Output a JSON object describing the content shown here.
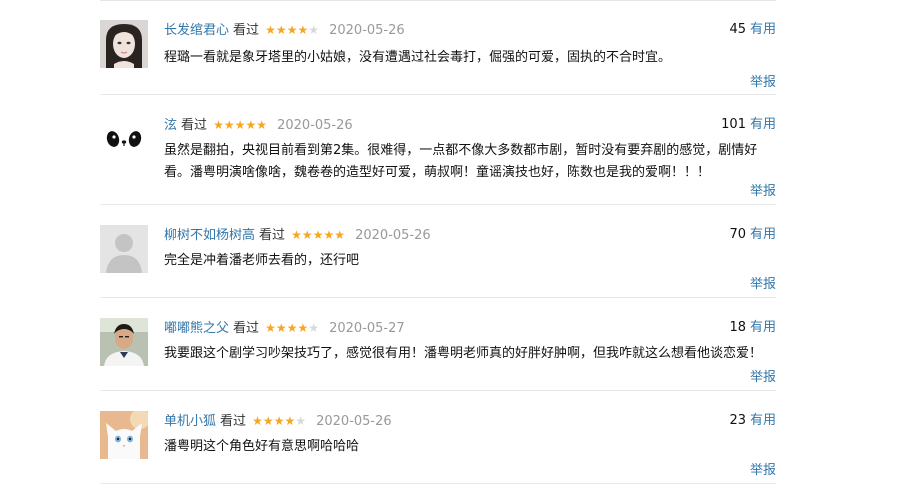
{
  "common": {
    "watched_label": "看过",
    "useful_label": "有用",
    "report_label": "举报"
  },
  "comments": [
    {
      "user": "长发绾君心",
      "rating": 4,
      "date": "2020-05-26",
      "votes": "45",
      "text": "程璐一看就是象牙塔里的小姑娘，没有遭遇过社会毒打，倔强的可爱，固执的不合时宜。",
      "avatar_icon": "girl-portrait-avatar"
    },
    {
      "user": "泫",
      "rating": 5,
      "date": "2020-05-26",
      "votes": "101",
      "text": "虽然是翻拍，央视目前看到第2集。很难得，一点都不像大多数都市剧，暂时没有要弃剧的感觉，剧情好看。潘粤明演啥像啥，魏卷卷的造型好可爱，萌叔啊！童谣演技也好，陈数也是我的爱啊！！！",
      "avatar_icon": "panda-face-avatar"
    },
    {
      "user": "柳树不如杨树高",
      "rating": 5,
      "date": "2020-05-26",
      "votes": "70",
      "text": "完全是冲着潘老师去看的，还行吧",
      "avatar_icon": "default-user-avatar"
    },
    {
      "user": "嘟嘟熊之父",
      "rating": 4,
      "date": "2020-05-27",
      "votes": "18",
      "text": "我要跟这个剧学习吵架技巧了，感觉很有用！潘粤明老师真的好胖好肿啊，但我咋就这么想看他谈恋爱！",
      "avatar_icon": "man-photo-avatar"
    },
    {
      "user": "单机小狐",
      "rating": 4,
      "date": "2020-05-26",
      "votes": "23",
      "text": "潘粤明这个角色好有意思啊哈哈哈",
      "avatar_icon": "white-cat-avatar"
    }
  ]
}
